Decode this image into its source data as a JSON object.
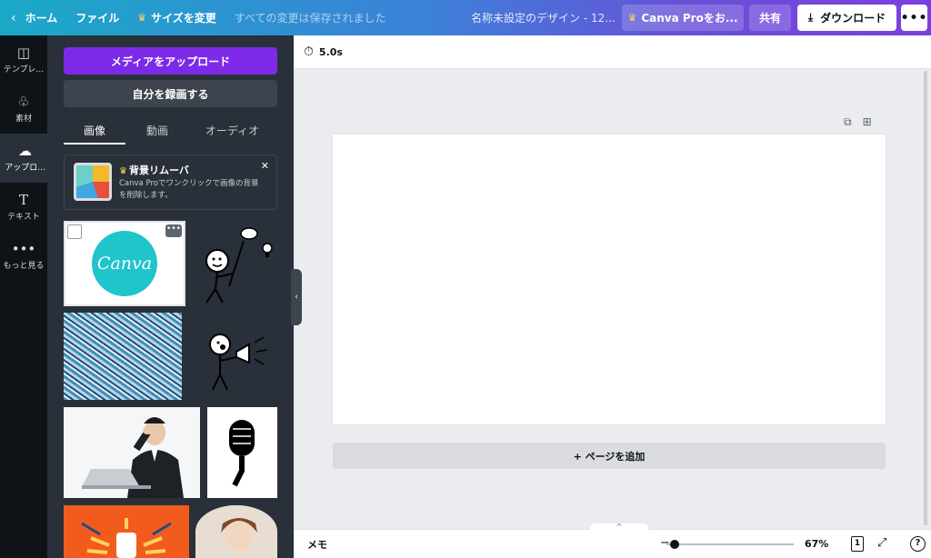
{
  "topbar": {
    "home_label": "ホーム",
    "file_label": "ファイル",
    "resize_label": "サイズを変更",
    "saved_status": "すべての変更は保存されました",
    "doc_title": "名称未設定のデザイン - 12...",
    "pro_label": "Canva Proをお...",
    "share_label": "共有",
    "download_label": "ダウンロード"
  },
  "rail": {
    "items": [
      {
        "label": "テンプレ..."
      },
      {
        "label": "素材"
      },
      {
        "label": "アップロ..."
      },
      {
        "label": "テキスト"
      },
      {
        "label": "もっと見る"
      }
    ],
    "active": "アップロ..."
  },
  "panel": {
    "upload_button": "メディアをアップロード",
    "record_button": "自分を録画する",
    "tabs": [
      {
        "label": "画像"
      },
      {
        "label": "動画"
      },
      {
        "label": "オーディオ"
      }
    ],
    "active_tab": "画像",
    "promo": {
      "title": "背景リムーバ",
      "desc": "Canva Proでワンクリックで画像の背景を削除します。"
    },
    "canva_thumb_text": "Canva"
  },
  "editor": {
    "duration": "5.0s",
    "add_page_label": "+ ページを追加"
  },
  "bottombar": {
    "memo_label": "メモ",
    "zoom": "67%",
    "zoom_fraction": 0.08,
    "page_count": "1",
    "help": "?"
  },
  "colors": {
    "accent_purple": "#7d2ae8",
    "panel_bg": "#293039",
    "rail_bg": "#0e1318",
    "canvas_bg": "#ebecf0"
  }
}
